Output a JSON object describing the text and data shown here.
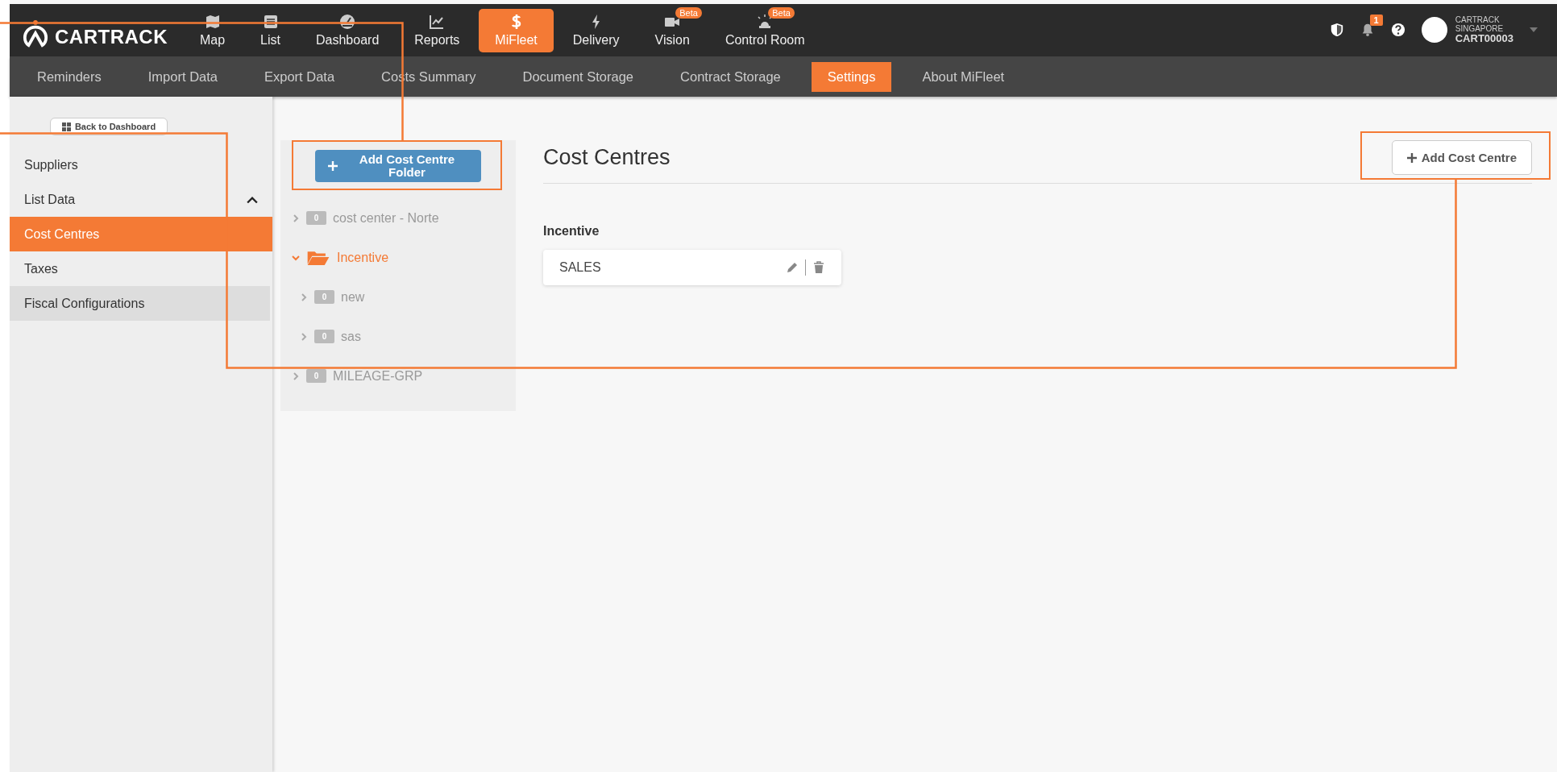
{
  "brand": "CARTRACK",
  "nav": [
    {
      "label": "Map",
      "selected": false
    },
    {
      "label": "List",
      "selected": false
    },
    {
      "label": "Dashboard",
      "selected": false
    },
    {
      "label": "Reports",
      "selected": false
    },
    {
      "label": "MiFleet",
      "selected": true
    },
    {
      "label": "Delivery",
      "selected": false
    },
    {
      "label": "Vision",
      "selected": false,
      "badge": "Beta"
    },
    {
      "label": "Control Room",
      "selected": false,
      "badge": "Beta"
    }
  ],
  "notifications": "1",
  "account": {
    "company": "CARTRACK",
    "region": "SINGAPORE",
    "code": "CART00003"
  },
  "subnav": [
    {
      "label": "Reminders",
      "selected": false
    },
    {
      "label": "Import Data",
      "selected": false
    },
    {
      "label": "Export Data",
      "selected": false
    },
    {
      "label": "Costs Summary",
      "selected": false
    },
    {
      "label": "Document Storage",
      "selected": false
    },
    {
      "label": "Contract Storage",
      "selected": false
    },
    {
      "label": "Settings",
      "selected": true
    },
    {
      "label": "About MiFleet",
      "selected": false
    }
  ],
  "sidebar": {
    "back_button": "Back to Dashboard",
    "items": [
      {
        "label": "Suppliers",
        "selected": false,
        "hovered": false
      },
      {
        "label": "List Data",
        "selected": false,
        "hovered": false,
        "expanded": true
      },
      {
        "label": "Cost Centres",
        "selected": true,
        "hovered": false
      },
      {
        "label": "Taxes",
        "selected": false,
        "hovered": false
      },
      {
        "label": "Fiscal Configurations",
        "selected": false,
        "hovered": true
      }
    ]
  },
  "folder_panel": {
    "add_button": "Add Cost Centre Folder",
    "tree": [
      {
        "label": "cost center - Norte",
        "count": "0",
        "expanded": false,
        "selected": false
      },
      {
        "label": "Incentive",
        "expanded": true,
        "selected": true,
        "children": [
          {
            "label": "new",
            "count": "0",
            "expanded": false,
            "selected": false
          },
          {
            "label": "sas",
            "count": "0",
            "expanded": false,
            "selected": false
          }
        ]
      },
      {
        "label": "MILEAGE-GRP",
        "count": "0",
        "expanded": false,
        "selected": false
      }
    ]
  },
  "content": {
    "title": "Cost Centres",
    "add_button": "Add Cost Centre",
    "group_title": "Incentive",
    "items": [
      {
        "name": "SALES"
      }
    ]
  }
}
